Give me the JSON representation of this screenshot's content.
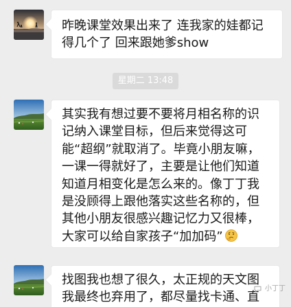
{
  "messages": [
    {
      "text": "昨晚课堂效果出来了 连我家的娃都记得几个了 回来跟她爹show",
      "avatar_icon": "sunset-beach-avatar-icon"
    },
    {
      "text": "其实我有想过要不要将月相名称的识记纳入课堂目标，但后来觉得这可能“超纲”就取消了。毕竟小朋友嘛，一课一得就好了，主要是让他们知道知道月相变化是怎么来的。像丁丁我是没顾得上跟他落实这些名称的，但其他小朋友很感兴趣记忆力又很棒，大家可以给自家孩子“加加码”",
      "avatar_icon": "green-field-avatar-icon",
      "emoji_icon": "thinking-emoji-icon"
    },
    {
      "text": "找图我也想了很久，太正规的天文图我最终也弃用了，都尽量找卡通、直观的",
      "avatar_icon": "green-field-avatar-icon"
    }
  ],
  "timestamp": "星期二 13:48",
  "watermark": "小丁丁",
  "colors": {
    "background": "#ededed",
    "bubble": "#ffffff",
    "bubble_border": "#e7e7e7",
    "timestamp_bg": "#dadada",
    "text": "#191919"
  }
}
